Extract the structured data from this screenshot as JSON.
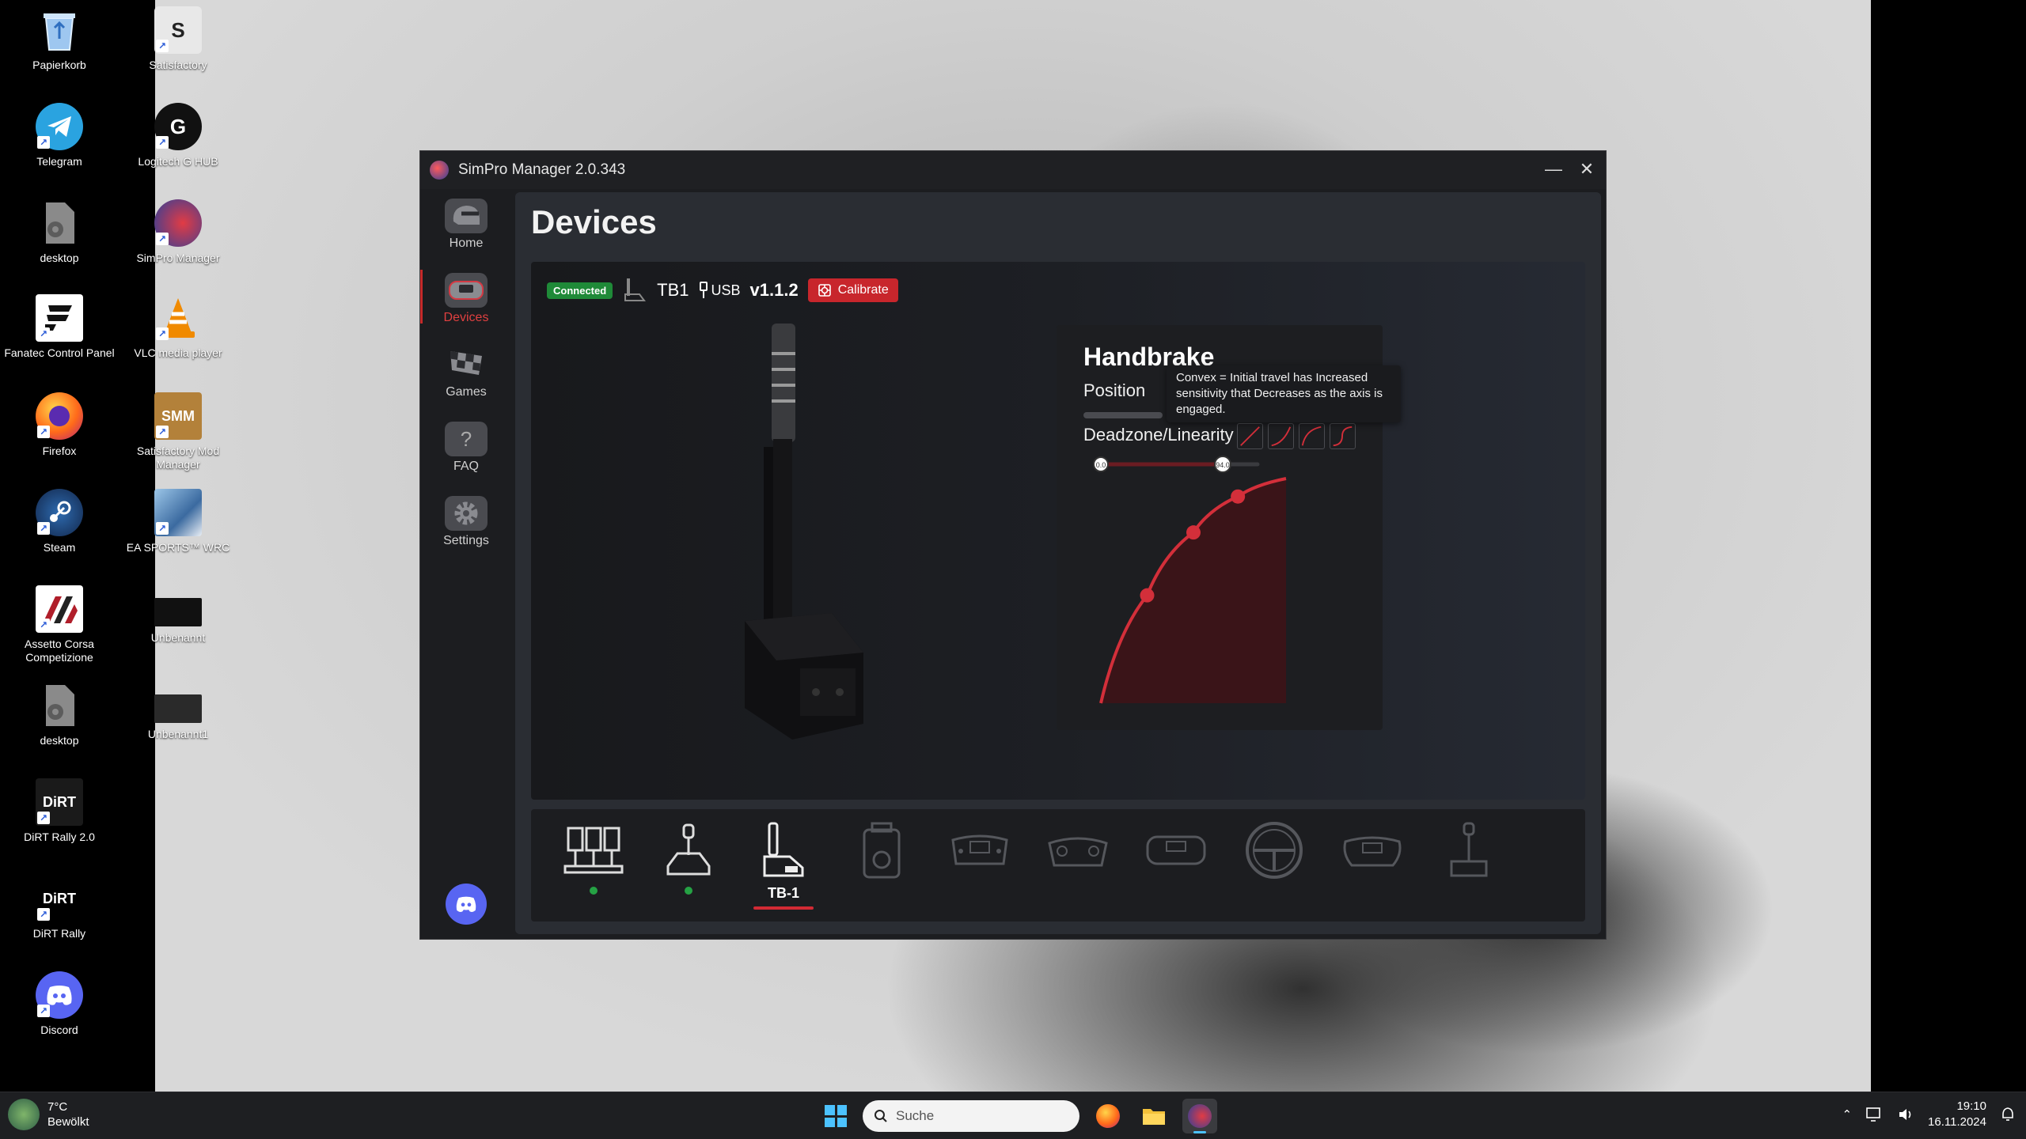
{
  "desktop": {
    "icons": [
      {
        "label": "Papierkorb",
        "icon": "recycle-bin-icon",
        "color": "#3a7bd5"
      },
      {
        "label": "Telegram",
        "icon": "telegram-icon",
        "color": "#2aa3e0"
      },
      {
        "label": "desktop",
        "icon": "file-gear-icon",
        "color": "#777777"
      },
      {
        "label": "Fanatec Control Panel",
        "icon": "fanatec-icon",
        "color": "#ffffff"
      },
      {
        "label": "Firefox",
        "icon": "firefox-icon",
        "color": "#ff6a1a"
      },
      {
        "label": "Steam",
        "icon": "steam-icon",
        "color": "#1b3a6b"
      },
      {
        "label": "Assetto Corsa Competizione",
        "icon": "acc-icon",
        "color": "#b01e2a"
      },
      {
        "label": "desktop",
        "icon": "file-gear-icon",
        "color": "#777777"
      },
      {
        "label": "DiRT Rally 2.0",
        "icon": "dirt-rally-2-icon",
        "color": "#222222"
      },
      {
        "label": "DiRT Rally",
        "icon": "dirt-rally-icon",
        "color": "#111111"
      },
      {
        "label": "Discord",
        "icon": "discord-icon",
        "color": "#5865f2"
      },
      {
        "label": "Satisfactory",
        "icon": "satisfactory-icon",
        "color": "#dddddd"
      },
      {
        "label": "Logitech G HUB",
        "icon": "logitech-icon",
        "color": "#111111"
      },
      {
        "label": "SimPro Manager",
        "icon": "simpro-icon",
        "color": "#c0303a"
      },
      {
        "label": "VLC media player",
        "icon": "vlc-icon",
        "color": "#f08a00"
      },
      {
        "label": "Satisfactory Mod Manager",
        "icon": "smm-icon",
        "color": "#a07030"
      },
      {
        "label": "EA SPORTS™ WRC",
        "icon": "wrc-icon",
        "color": "#3b6aa0"
      },
      {
        "label": "Unbenannt",
        "icon": "image-icon",
        "color": "#222222"
      },
      {
        "label": "Unbenannt1",
        "icon": "image-icon",
        "color": "#333333"
      }
    ]
  },
  "app": {
    "title": "SimPro Manager 2.0.343",
    "minimize": "—",
    "close": "✕",
    "nav": [
      {
        "label": "Home",
        "icon": "helmet-icon"
      },
      {
        "label": "Devices",
        "icon": "wheel-icon"
      },
      {
        "label": "Games",
        "icon": "checkered-flag-icon"
      },
      {
        "label": "FAQ",
        "icon": "question-icon"
      },
      {
        "label": "Settings",
        "icon": "gear-icon"
      }
    ],
    "page_title": "Devices",
    "status": {
      "badge": "Connected",
      "device": "TB1",
      "connection": "USB",
      "firmware": "v1.1.2",
      "calibrate": "Calibrate"
    },
    "handbrake": {
      "title": "Handbrake",
      "position_label": "Position",
      "position_value": 0.0,
      "deadzone_label": "Deadzone/Linearity",
      "deadzone_min": "0.0",
      "deadzone_max": "94.0",
      "curve_points": [
        [
          0,
          0
        ],
        [
          0.25,
          0.48
        ],
        [
          0.5,
          0.76
        ],
        [
          0.74,
          0.92
        ],
        [
          1,
          1
        ]
      ],
      "accent": "#d32f3a"
    },
    "tooltip": "Convex = Initial travel has Increased sensitivity that Decreases as the axis is engaged.",
    "devices_bar": [
      {
        "icon": "pedals-icon",
        "label": "",
        "connected": true
      },
      {
        "icon": "shifter-icon",
        "label": "",
        "connected": true
      },
      {
        "icon": "handbrake-icon",
        "label": "TB-1",
        "connected": false,
        "selected": true
      },
      {
        "icon": "button-box-icon",
        "label": "",
        "connected": false
      },
      {
        "icon": "formula-wheel-icon",
        "label": "",
        "connected": false
      },
      {
        "icon": "gamepad-wheel-icon",
        "label": "",
        "connected": false
      },
      {
        "icon": "gt-wheel-icon",
        "label": "",
        "connected": false
      },
      {
        "icon": "round-wheel-icon",
        "label": "",
        "connected": false
      },
      {
        "icon": "rally-wheel-icon",
        "label": "",
        "connected": false
      },
      {
        "icon": "joystick-icon",
        "label": "",
        "connected": false
      }
    ]
  },
  "taskbar": {
    "weather_temp": "7°C",
    "weather_desc": "Bewölkt",
    "search_placeholder": "Suche",
    "time": "19:10",
    "date": "16.11.2024"
  }
}
